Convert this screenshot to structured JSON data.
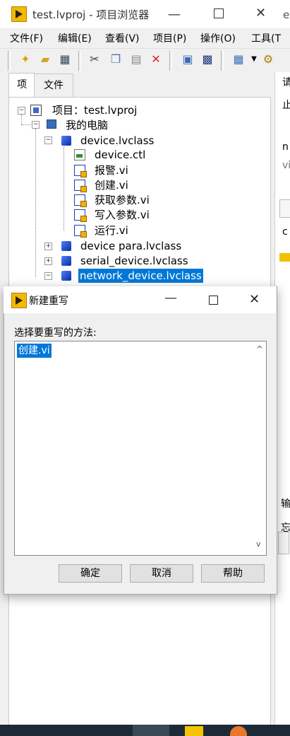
{
  "main_window": {
    "title": "test.lvproj - 项目浏览器",
    "title_suffix_fragment": "e",
    "menu": [
      "文件(F)",
      "编辑(E)",
      "查看(V)",
      "项目(P)",
      "操作(O)",
      "工具(T"
    ],
    "tabs": [
      "项",
      "文件"
    ],
    "tree": {
      "project": "项目：test.lvproj",
      "computer": "我的电脑",
      "class1": "device.lvclass",
      "class1_items": [
        "device.ctl",
        "报警.vi",
        "创建.vi",
        "获取参数.vi",
        "写入参数.vi",
        "运行.vi"
      ],
      "class2": "device para.lvclass",
      "class3": "serial_device.lvclass",
      "class4": "network_device.lvclass"
    },
    "right_fragments": [
      "请",
      "止",
      "n",
      "vi",
      "c",
      "输",
      "忘"
    ]
  },
  "dialog": {
    "title": "新建重写",
    "prompt": "选择要重写的方法:",
    "list_items": [
      "创建.vi"
    ],
    "buttons": {
      "ok": "确定",
      "cancel": "取消",
      "help": "帮助"
    }
  },
  "colors": {
    "selection": "#0078d7",
    "labview_yellow": "#f5b800"
  },
  "icons": [
    "labview-logo-icon",
    "minimize-icon",
    "maximize-icon",
    "close-icon",
    "new-file-icon",
    "open-folder-icon",
    "save-all-icon",
    "cut-icon",
    "copy-icon",
    "paste-icon",
    "delete-icon",
    "class-cube-icon",
    "vi-icon",
    "control-icon",
    "computer-icon",
    "project-icon"
  ]
}
